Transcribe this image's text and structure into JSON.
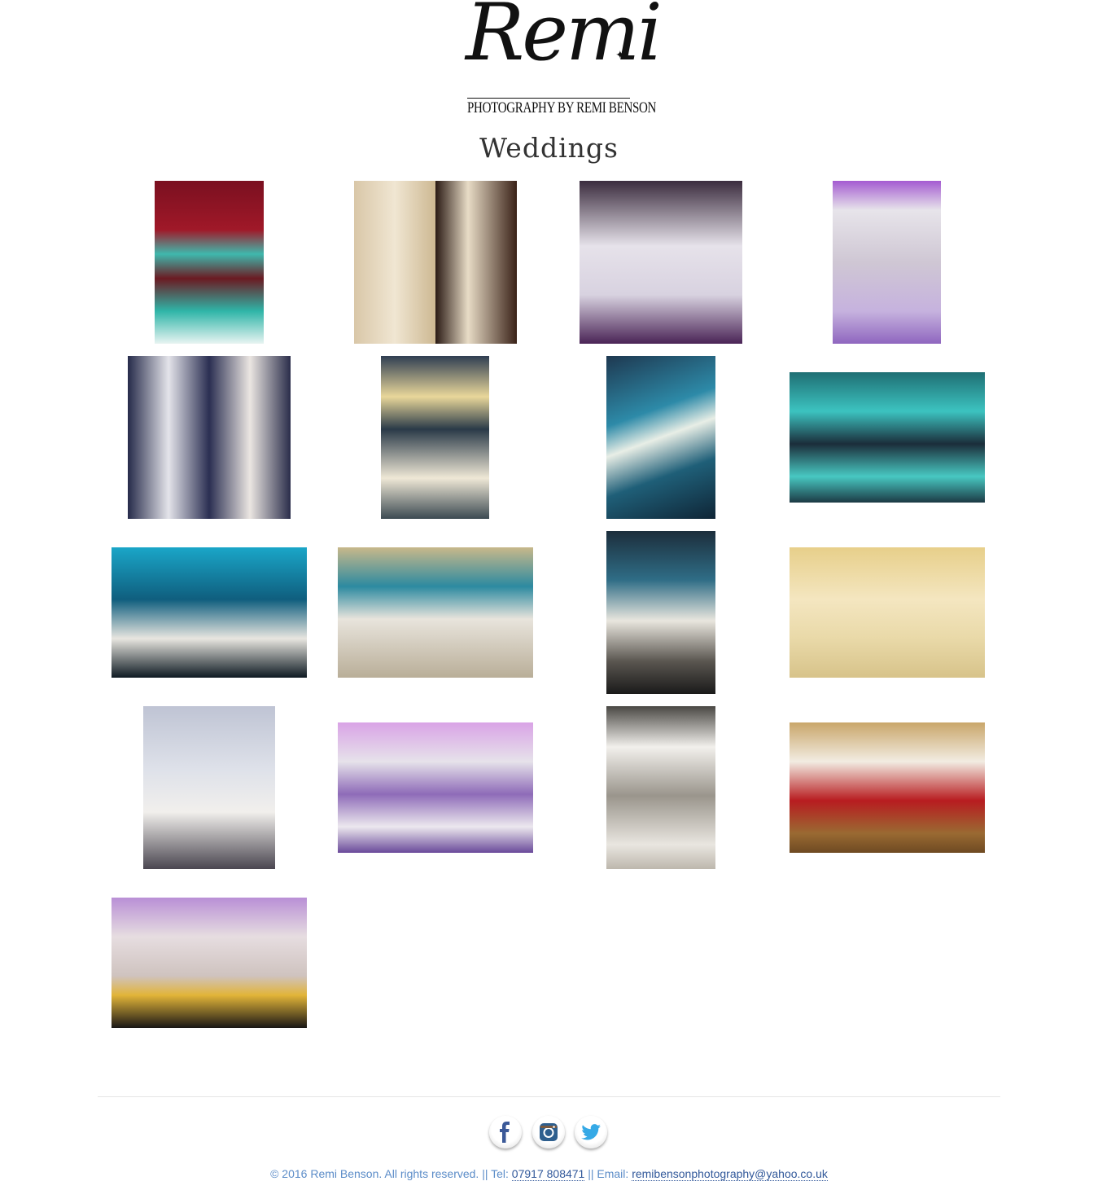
{
  "logo": {
    "script": "Remi",
    "subtitle": "PHOTOGRAPHY BY REMI BENSON"
  },
  "page_title": "Weddings",
  "gallery": [
    "cake-photo",
    "cake-photo",
    "cake-photo",
    "cake-photo",
    "cake-photo",
    "cake-photo",
    "decor-photo",
    "decor-photo",
    "decor-photo",
    "decor-photo",
    "decor-photo",
    "decor-photo",
    "decor-photo",
    "decor-photo",
    "decor-photo",
    "decor-photo",
    "decor-photo"
  ],
  "social": [
    "facebook-icon",
    "instagram-icon",
    "twitter-icon"
  ],
  "footer": {
    "copyright": "© 2016 Remi Benson. All rights reserved. || Tel: ",
    "phone": "07917 808471",
    "sep": " || Email: ",
    "email": "remibensonphotography@yahoo.co.uk"
  },
  "colors": {
    "link": "#31589a",
    "footer_text": "#5b8cc8"
  }
}
